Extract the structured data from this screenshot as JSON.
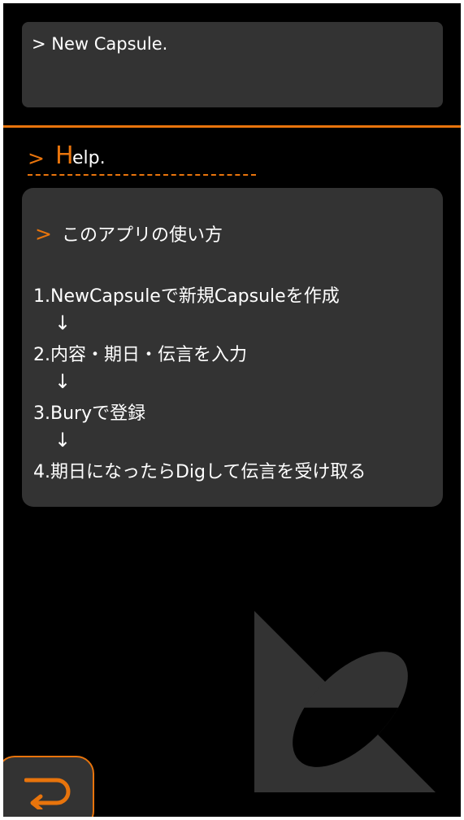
{
  "top_panel": {
    "label": "> New Capsule."
  },
  "help_heading": {
    "prompt": ">",
    "initial": "H",
    "rest": "elp."
  },
  "help_card": {
    "title_prompt": ">",
    "title": "このアプリの使い方",
    "steps": [
      "1.NewCapsuleで新規Capsuleを作成",
      "2.内容・期日・伝言を入力",
      "3.Buryで登録",
      "4.期日になったらDigして伝言を受け取る"
    ],
    "arrow": "↓"
  },
  "icons": {
    "back": "return-arrow-icon",
    "logo": "capsule-logo-icon"
  },
  "colors": {
    "accent": "#e8740c",
    "panel": "#333333",
    "background": "#000000",
    "text": "#ffffff"
  }
}
